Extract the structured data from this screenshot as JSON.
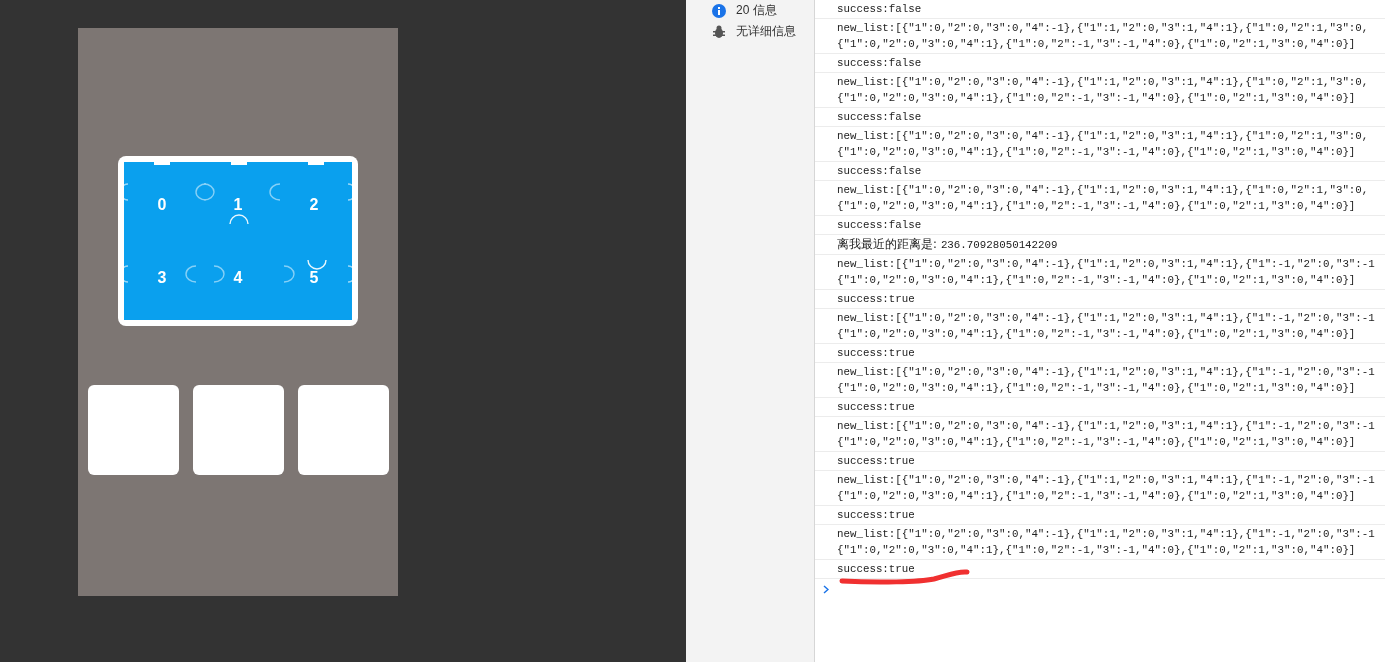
{
  "sidebar": {
    "items": [
      {
        "kind": "info",
        "label": "20 信息"
      },
      {
        "kind": "verbose",
        "label": "无详细信息"
      }
    ]
  },
  "puzzle": {
    "pieces": [
      "0",
      "1",
      "2",
      "3",
      "4",
      "5"
    ]
  },
  "slots": [
    {
      "kind": "empty"
    },
    {
      "kind": "empty"
    },
    {
      "kind": "empty"
    }
  ],
  "console": {
    "entries": [
      {
        "kind": "log",
        "text": "success:false"
      },
      {
        "kind": "list",
        "lines": [
          "new_list:[{\"1\":0,\"2\":0,\"3\":0,\"4\":-1},{\"1\":1,\"2\":0,\"3\":1,\"4\":1},{\"1\":0,\"2\":1,\"3\":0,",
          "{\"1\":0,\"2\":0,\"3\":0,\"4\":1},{\"1\":0,\"2\":-1,\"3\":-1,\"4\":0},{\"1\":0,\"2\":1,\"3\":0,\"4\":0}]"
        ]
      },
      {
        "kind": "log",
        "text": "success:false"
      },
      {
        "kind": "list",
        "lines": [
          "new_list:[{\"1\":0,\"2\":0,\"3\":0,\"4\":-1},{\"1\":1,\"2\":0,\"3\":1,\"4\":1},{\"1\":0,\"2\":1,\"3\":0,",
          "{\"1\":0,\"2\":0,\"3\":0,\"4\":1},{\"1\":0,\"2\":-1,\"3\":-1,\"4\":0},{\"1\":0,\"2\":1,\"3\":0,\"4\":0}]"
        ]
      },
      {
        "kind": "log",
        "text": "success:false"
      },
      {
        "kind": "list",
        "lines": [
          "new_list:[{\"1\":0,\"2\":0,\"3\":0,\"4\":-1},{\"1\":1,\"2\":0,\"3\":1,\"4\":1},{\"1\":0,\"2\":1,\"3\":0,",
          "{\"1\":0,\"2\":0,\"3\":0,\"4\":1},{\"1\":0,\"2\":-1,\"3\":-1,\"4\":0},{\"1\":0,\"2\":1,\"3\":0,\"4\":0}]"
        ]
      },
      {
        "kind": "log",
        "text": "success:false"
      },
      {
        "kind": "list",
        "lines": [
          "new_list:[{\"1\":0,\"2\":0,\"3\":0,\"4\":-1},{\"1\":1,\"2\":0,\"3\":1,\"4\":1},{\"1\":0,\"2\":1,\"3\":0,",
          "{\"1\":0,\"2\":0,\"3\":0,\"4\":1},{\"1\":0,\"2\":-1,\"3\":-1,\"4\":0},{\"1\":0,\"2\":1,\"3\":0,\"4\":0}]"
        ]
      },
      {
        "kind": "log",
        "text": "success:false"
      },
      {
        "kind": "distance",
        "label": "离我最近的距离是:",
        "value": "236.70928050142209"
      },
      {
        "kind": "list",
        "lines": [
          "new_list:[{\"1\":0,\"2\":0,\"3\":0,\"4\":-1},{\"1\":1,\"2\":0,\"3\":1,\"4\":1},{\"1\":-1,\"2\":0,\"3\":-1",
          "{\"1\":0,\"2\":0,\"3\":0,\"4\":1},{\"1\":0,\"2\":-1,\"3\":-1,\"4\":0},{\"1\":0,\"2\":1,\"3\":0,\"4\":0}]"
        ]
      },
      {
        "kind": "log",
        "text": "success:true"
      },
      {
        "kind": "list",
        "lines": [
          "new_list:[{\"1\":0,\"2\":0,\"3\":0,\"4\":-1},{\"1\":1,\"2\":0,\"3\":1,\"4\":1},{\"1\":-1,\"2\":0,\"3\":-1",
          "{\"1\":0,\"2\":0,\"3\":0,\"4\":1},{\"1\":0,\"2\":-1,\"3\":-1,\"4\":0},{\"1\":0,\"2\":1,\"3\":0,\"4\":0}]"
        ]
      },
      {
        "kind": "log",
        "text": "success:true"
      },
      {
        "kind": "list",
        "lines": [
          "new_list:[{\"1\":0,\"2\":0,\"3\":0,\"4\":-1},{\"1\":1,\"2\":0,\"3\":1,\"4\":1},{\"1\":-1,\"2\":0,\"3\":-1",
          "{\"1\":0,\"2\":0,\"3\":0,\"4\":1},{\"1\":0,\"2\":-1,\"3\":-1,\"4\":0},{\"1\":0,\"2\":1,\"3\":0,\"4\":0}]"
        ]
      },
      {
        "kind": "log",
        "text": "success:true"
      },
      {
        "kind": "list",
        "lines": [
          "new_list:[{\"1\":0,\"2\":0,\"3\":0,\"4\":-1},{\"1\":1,\"2\":0,\"3\":1,\"4\":1},{\"1\":-1,\"2\":0,\"3\":-1",
          "{\"1\":0,\"2\":0,\"3\":0,\"4\":1},{\"1\":0,\"2\":-1,\"3\":-1,\"4\":0},{\"1\":0,\"2\":1,\"3\":0,\"4\":0}]"
        ]
      },
      {
        "kind": "log",
        "text": "success:true"
      },
      {
        "kind": "list",
        "lines": [
          "new_list:[{\"1\":0,\"2\":0,\"3\":0,\"4\":-1},{\"1\":1,\"2\":0,\"3\":1,\"4\":1},{\"1\":-1,\"2\":0,\"3\":-1",
          "{\"1\":0,\"2\":0,\"3\":0,\"4\":1},{\"1\":0,\"2\":-1,\"3\":-1,\"4\":0},{\"1\":0,\"2\":1,\"3\":0,\"4\":0}]"
        ]
      },
      {
        "kind": "log",
        "text": "success:true"
      },
      {
        "kind": "list",
        "lines": [
          "new_list:[{\"1\":0,\"2\":0,\"3\":0,\"4\":-1},{\"1\":1,\"2\":0,\"3\":1,\"4\":1},{\"1\":-1,\"2\":0,\"3\":-1",
          "{\"1\":0,\"2\":0,\"3\":0,\"4\":1},{\"1\":0,\"2\":-1,\"3\":-1,\"4\":0},{\"1\":0,\"2\":1,\"3\":0,\"4\":0}]"
        ]
      },
      {
        "kind": "log",
        "text": "success:true"
      }
    ]
  }
}
